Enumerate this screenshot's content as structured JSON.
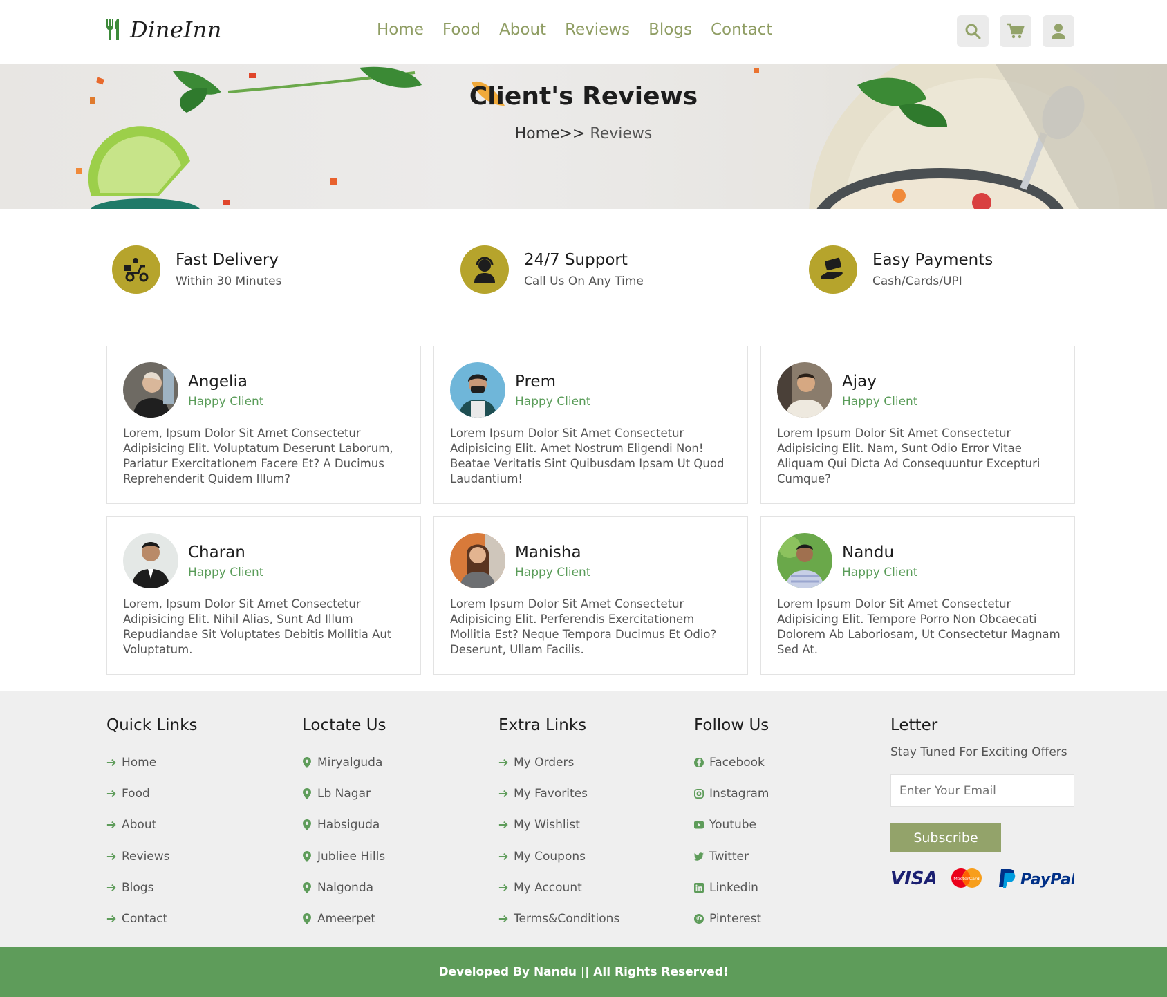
{
  "header": {
    "brand": "DineInn",
    "nav": [
      "Home",
      "Food",
      "About",
      "Reviews",
      "Blogs",
      "Contact"
    ]
  },
  "hero": {
    "title": "Client's Reviews",
    "crumb_home": "Home>>",
    "crumb_current": " Reviews"
  },
  "features": [
    {
      "title": "Fast Delivery",
      "sub": "Within 30 Minutes",
      "icon": "delivery-icon"
    },
    {
      "title": "24/7 Support",
      "sub": "Call Us On Any Time",
      "icon": "support-icon"
    },
    {
      "title": "Easy Payments",
      "sub": "Cash/Cards/UPI",
      "icon": "payment-icon"
    }
  ],
  "reviews": [
    {
      "name": "Angelia",
      "role": "Happy Client",
      "text": "Lorem, Ipsum Dolor Sit Amet Consectetur Adipisicing Elit. Voluptatum Deserunt Laborum, Pariatur Exercitationem Facere Et? A Ducimus Reprehenderit Quidem Illum?"
    },
    {
      "name": "Prem",
      "role": "Happy Client",
      "text": "Lorem Ipsum Dolor Sit Amet Consectetur Adipisicing Elit. Amet Nostrum Eligendi Non! Beatae Veritatis Sint Quibusdam Ipsam Ut Quod Laudantium!"
    },
    {
      "name": "Ajay",
      "role": "Happy Client",
      "text": "Lorem Ipsum Dolor Sit Amet Consectetur Adipisicing Elit. Nam, Sunt Odio Error Vitae Aliquam Qui Dicta Ad Consequuntur Excepturi Cumque?"
    },
    {
      "name": "Charan",
      "role": "Happy Client",
      "text": "Lorem, Ipsum Dolor Sit Amet Consectetur Adipisicing Elit. Nihil Alias, Sunt Ad Illum Repudiandae Sit Voluptates Debitis Mollitia Aut Voluptatum."
    },
    {
      "name": "Manisha",
      "role": "Happy Client",
      "text": "Lorem Ipsum Dolor Sit Amet Consectetur Adipisicing Elit. Perferendis Exercitationem Mollitia Est? Neque Tempora Ducimus Et Odio? Deserunt, Ullam Facilis."
    },
    {
      "name": "Nandu",
      "role": "Happy Client",
      "text": "Lorem Ipsum Dolor Sit Amet Consectetur Adipisicing Elit. Tempore Porro Non Obcaecati Dolorem Ab Laboriosam, Ut Consectetur Magnam Sed At."
    }
  ],
  "footer": {
    "quick": {
      "title": "Quick Links",
      "items": [
        "Home",
        "Food",
        "About",
        "Reviews",
        "Blogs",
        "Contact"
      ]
    },
    "locate": {
      "title": "Loctate Us",
      "items": [
        "Miryalguda",
        "Lb Nagar",
        "Habsiguda",
        "Jubliee Hills",
        "Nalgonda",
        "Ameerpet"
      ]
    },
    "extra": {
      "title": "Extra Links",
      "items": [
        "My Orders",
        "My Favorites",
        "My Wishlist",
        "My Coupons",
        "My Account",
        "Terms&Conditions"
      ]
    },
    "follow": {
      "title": "Follow Us",
      "items": [
        "Facebook",
        "Instagram",
        "Youtube",
        "Twitter",
        "Linkedin",
        "Pinterest"
      ]
    },
    "letter": {
      "title": "Letter",
      "sub": "Stay Tuned For Exciting Offers",
      "placeholder": "Enter Your Email",
      "button": "Subscribe",
      "payments": [
        "VISA",
        "MasterCard",
        "PayPal"
      ]
    }
  },
  "bottom": "Developed By Nandu || All Rights Reserved!",
  "colors": {
    "accent": "#93a36a",
    "green": "#5e9c5a",
    "gold": "#b6a42c"
  }
}
